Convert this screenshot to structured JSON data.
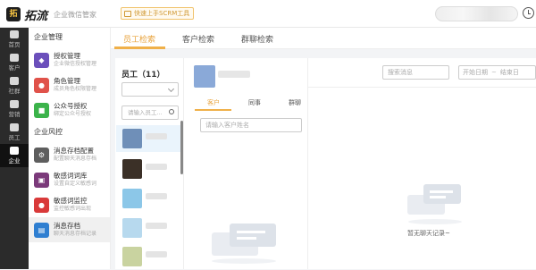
{
  "app": {
    "logo_glyph": "拓",
    "name": "拓流",
    "subtitle": "企业微信管家",
    "promo": "快速上手SCRM工具"
  },
  "rail": [
    {
      "label": "首页",
      "icon": "home-icon"
    },
    {
      "label": "客户",
      "icon": "customer-icon"
    },
    {
      "label": "社群",
      "icon": "group-icon"
    },
    {
      "label": "营销",
      "icon": "marketing-icon"
    },
    {
      "label": "员工",
      "icon": "staff-icon"
    },
    {
      "label": "企业",
      "icon": "enterprise-icon",
      "active": true
    }
  ],
  "menu": {
    "section1": "企业管理",
    "section2": "企业风控",
    "items": [
      {
        "title": "授权管理",
        "desc": "企业微信授权管理",
        "color": "#6b4fbb",
        "glyph": "◆"
      },
      {
        "title": "角色管理",
        "desc": "成员角色权限管理",
        "color": "#e0524a",
        "glyph": "●"
      },
      {
        "title": "公众号授权",
        "desc": "绑定公众号授权",
        "color": "#3bb34a",
        "glyph": "■"
      },
      {
        "title": "消息存档配置",
        "desc": "配置聊天消息存档",
        "color": "#5e5e5e",
        "glyph": "⚙"
      },
      {
        "title": "敏感词词库",
        "desc": "设置自定义敏感词",
        "color": "#7b3a7a",
        "glyph": "▣"
      },
      {
        "title": "敏感词监控",
        "desc": "监控敏感词出现",
        "color": "#d93a3a",
        "glyph": "●"
      },
      {
        "title": "消息存档",
        "desc": "聊天消息存档记录",
        "color": "#2f7fd1",
        "glyph": "▤",
        "active": true
      }
    ]
  },
  "tabs": [
    {
      "label": "员工检索",
      "active": true
    },
    {
      "label": "客户检索"
    },
    {
      "label": "群聊检索"
    }
  ],
  "employees": {
    "header": "员工（11）",
    "search_placeholder": "请输入员工...",
    "items": [
      {
        "avatar_color": "#6f8fb8",
        "active": true
      },
      {
        "avatar_color": "#3b3027"
      },
      {
        "avatar_color": "#8cc7e8"
      },
      {
        "avatar_color": "#b7d9ee"
      },
      {
        "avatar_color": "#c9d3a0"
      }
    ]
  },
  "customer_panel": {
    "subtabs": [
      {
        "label": "客户",
        "active": true
      },
      {
        "label": "同事"
      },
      {
        "label": "群聊"
      }
    ],
    "search_placeholder": "请输入客户姓名"
  },
  "messages": {
    "search_placeholder": "搜索消息",
    "date_start": "开始日期",
    "date_sep": "~",
    "date_end": "结束日",
    "empty_text": "暂无聊天记录~"
  }
}
